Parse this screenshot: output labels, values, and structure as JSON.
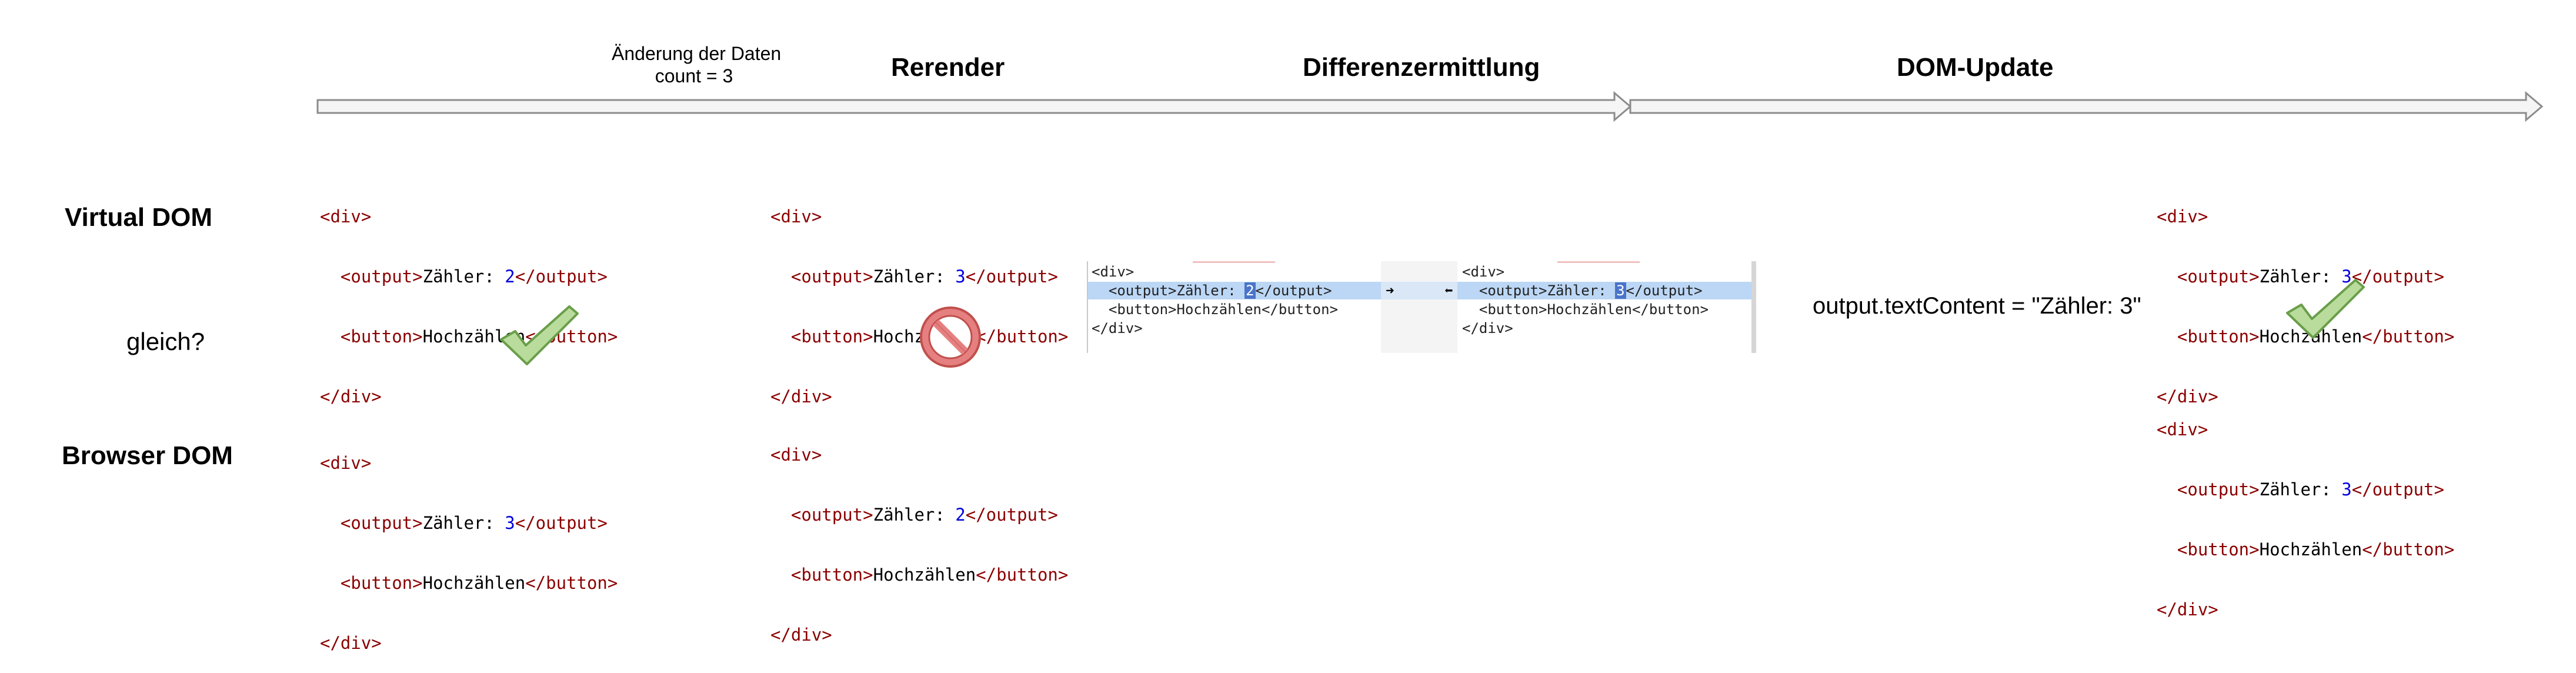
{
  "phases": {
    "event": [
      "Änderung der Daten",
      "count = 3"
    ],
    "rerender": "Rerender",
    "diff": "Differenzermittlung",
    "update": "DOM-Update"
  },
  "rows": {
    "virtual": "Virtual DOM",
    "compare": "gleich?",
    "browser": "Browser DOM"
  },
  "code": {
    "open": "<div>",
    "close": "</div>",
    "output_open": "<output>",
    "output_close": "</output>",
    "button_open": "<button>",
    "button_close": "</button>",
    "counter_label": "Zähler: ",
    "button_text": "Hochzählen"
  },
  "snapshots": {
    "vdom_initial": "2",
    "bdom_initial": "3",
    "vdom_rerender": "3",
    "bdom_rerender": "2",
    "vdom_final": "3",
    "bdom_final": "3"
  },
  "diff": {
    "left": {
      "line1": "<div>",
      "line2_before": "  <output>Zähler: ",
      "line2_changed": "2",
      "line2_after": "</output>",
      "line3": "  <button>Hochzählen</button>",
      "line4": "</div>"
    },
    "right": {
      "line1": "<div>",
      "line2_before": "  <output>Zähler: ",
      "line2_changed": "3",
      "line2_after": "</output>",
      "line3": "  <button>Hochzählen</button>",
      "line4": "</div>"
    },
    "arrow_right": "➜",
    "arrow_left": "⬅"
  },
  "update_statement": "output.textContent = \"Zähler: 3\"",
  "colors": {
    "tag": "#8b0000",
    "number": "#0000dd",
    "check_fill": "#b9dc9c",
    "check_stroke": "#6a9e4a",
    "stop_fill": "#e68080",
    "stop_stroke": "#c0504d",
    "diff_highlight": "#bcd7f5",
    "arrow_fill": "#f5f5f5",
    "arrow_stroke": "#8c8c8c"
  },
  "icons": {
    "equal_initial": "check-icon",
    "equal_rerender": "stop-icon",
    "equal_final": "check-icon"
  }
}
